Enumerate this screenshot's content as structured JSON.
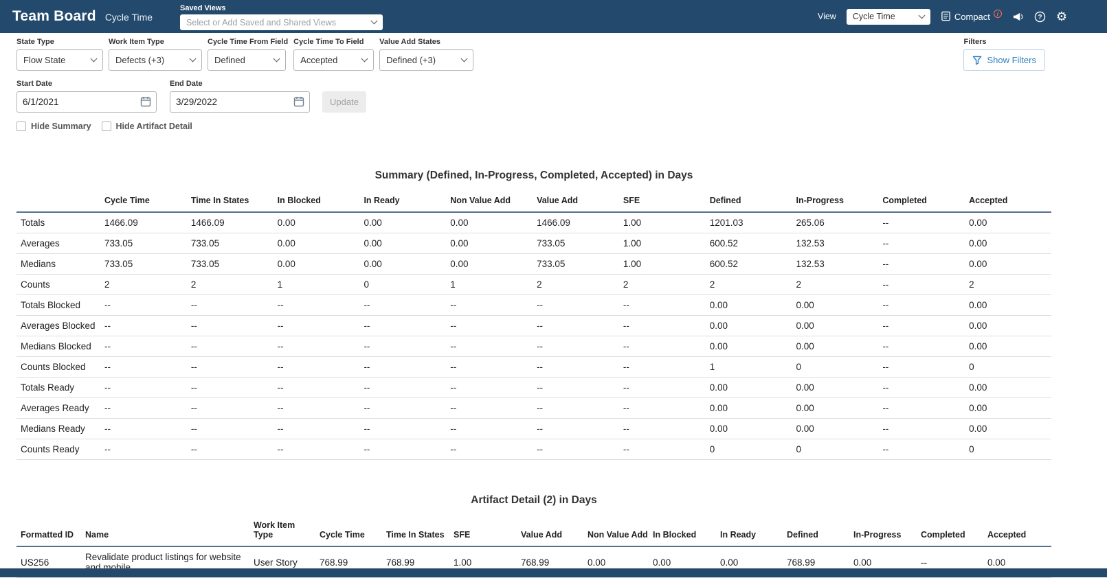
{
  "colors": {
    "header_bg": "#234a6d",
    "accent_blue": "#2f7fc1",
    "table_header_border": "#54708e",
    "badge_red": "#ff6d5a"
  },
  "header": {
    "title": "Team Board",
    "subtitle": "Cycle Time",
    "saved_views_label": "Saved Views",
    "saved_views_placeholder": "Select or Add Saved and Shared Views",
    "view_label": "View",
    "view_value": "Cycle Time",
    "compact_label": "Compact",
    "compact_badge": "i"
  },
  "filters": {
    "state_type_label": "State Type",
    "state_type_value": "Flow State",
    "work_item_type_label": "Work Item Type",
    "work_item_type_value": "Defects (+3)",
    "cycle_time_from_label": "Cycle Time From Field",
    "cycle_time_from_value": "Defined",
    "cycle_time_to_label": "Cycle Time To Field",
    "cycle_time_to_value": "Accepted",
    "value_add_states_label": "Value Add States",
    "value_add_states_value": "Defined (+3)",
    "filters_label": "Filters",
    "show_filters_button": "Show Filters",
    "start_date_label": "Start Date",
    "start_date_value": "6/1/2021",
    "end_date_label": "End Date",
    "end_date_value": "3/29/2022",
    "update_button": "Update",
    "hide_summary_label": "Hide Summary",
    "hide_artifact_detail_label": "Hide Artifact Detail"
  },
  "summary_table": {
    "title": "Summary (Defined, In-Progress, Completed, Accepted) in Days",
    "columns": [
      "",
      "Cycle Time",
      "Time In States",
      "In Blocked",
      "In Ready",
      "Non Value Add",
      "Value Add",
      "SFE",
      "Defined",
      "In-Progress",
      "Completed",
      "Accepted"
    ],
    "rows": [
      [
        "Totals",
        "1466.09",
        "1466.09",
        "0.00",
        "0.00",
        "0.00",
        "1466.09",
        "1.00",
        "1201.03",
        "265.06",
        "--",
        "0.00"
      ],
      [
        "Averages",
        "733.05",
        "733.05",
        "0.00",
        "0.00",
        "0.00",
        "733.05",
        "1.00",
        "600.52",
        "132.53",
        "--",
        "0.00"
      ],
      [
        "Medians",
        "733.05",
        "733.05",
        "0.00",
        "0.00",
        "0.00",
        "733.05",
        "1.00",
        "600.52",
        "132.53",
        "--",
        "0.00"
      ],
      [
        "Counts",
        "2",
        "2",
        "1",
        "0",
        "1",
        "2",
        "2",
        "2",
        "2",
        "--",
        "2"
      ],
      [
        "Totals Blocked",
        "--",
        "--",
        "--",
        "--",
        "--",
        "--",
        "--",
        "0.00",
        "0.00",
        "--",
        "0.00"
      ],
      [
        "Averages Blocked",
        "--",
        "--",
        "--",
        "--",
        "--",
        "--",
        "--",
        "0.00",
        "0.00",
        "--",
        "0.00"
      ],
      [
        "Medians Blocked",
        "--",
        "--",
        "--",
        "--",
        "--",
        "--",
        "--",
        "0.00",
        "0.00",
        "--",
        "0.00"
      ],
      [
        "Counts Blocked",
        "--",
        "--",
        "--",
        "--",
        "--",
        "--",
        "--",
        "1",
        "0",
        "--",
        "0"
      ],
      [
        "Totals Ready",
        "--",
        "--",
        "--",
        "--",
        "--",
        "--",
        "--",
        "0.00",
        "0.00",
        "--",
        "0.00"
      ],
      [
        "Averages Ready",
        "--",
        "--",
        "--",
        "--",
        "--",
        "--",
        "--",
        "0.00",
        "0.00",
        "--",
        "0.00"
      ],
      [
        "Medians Ready",
        "--",
        "--",
        "--",
        "--",
        "--",
        "--",
        "--",
        "0.00",
        "0.00",
        "--",
        "0.00"
      ],
      [
        "Counts Ready",
        "--",
        "--",
        "--",
        "--",
        "--",
        "--",
        "--",
        "0",
        "0",
        "--",
        "0"
      ]
    ]
  },
  "artifact_table": {
    "title": "Artifact Detail (2) in Days",
    "columns": [
      "Formatted ID",
      "Name",
      "Work Item Type",
      "Cycle Time",
      "Time In States",
      "SFE",
      "Value Add",
      "Non Value Add",
      "In Blocked",
      "In Ready",
      "Defined",
      "In-Progress",
      "Completed",
      "Accepted"
    ],
    "rows": [
      [
        "US256",
        "Revalidate product listings for website and mobile",
        "User Story",
        "768.99",
        "768.99",
        "1.00",
        "768.99",
        "0.00",
        "0.00",
        "0.00",
        "768.99",
        "0.00",
        "--",
        "0.00"
      ]
    ]
  }
}
